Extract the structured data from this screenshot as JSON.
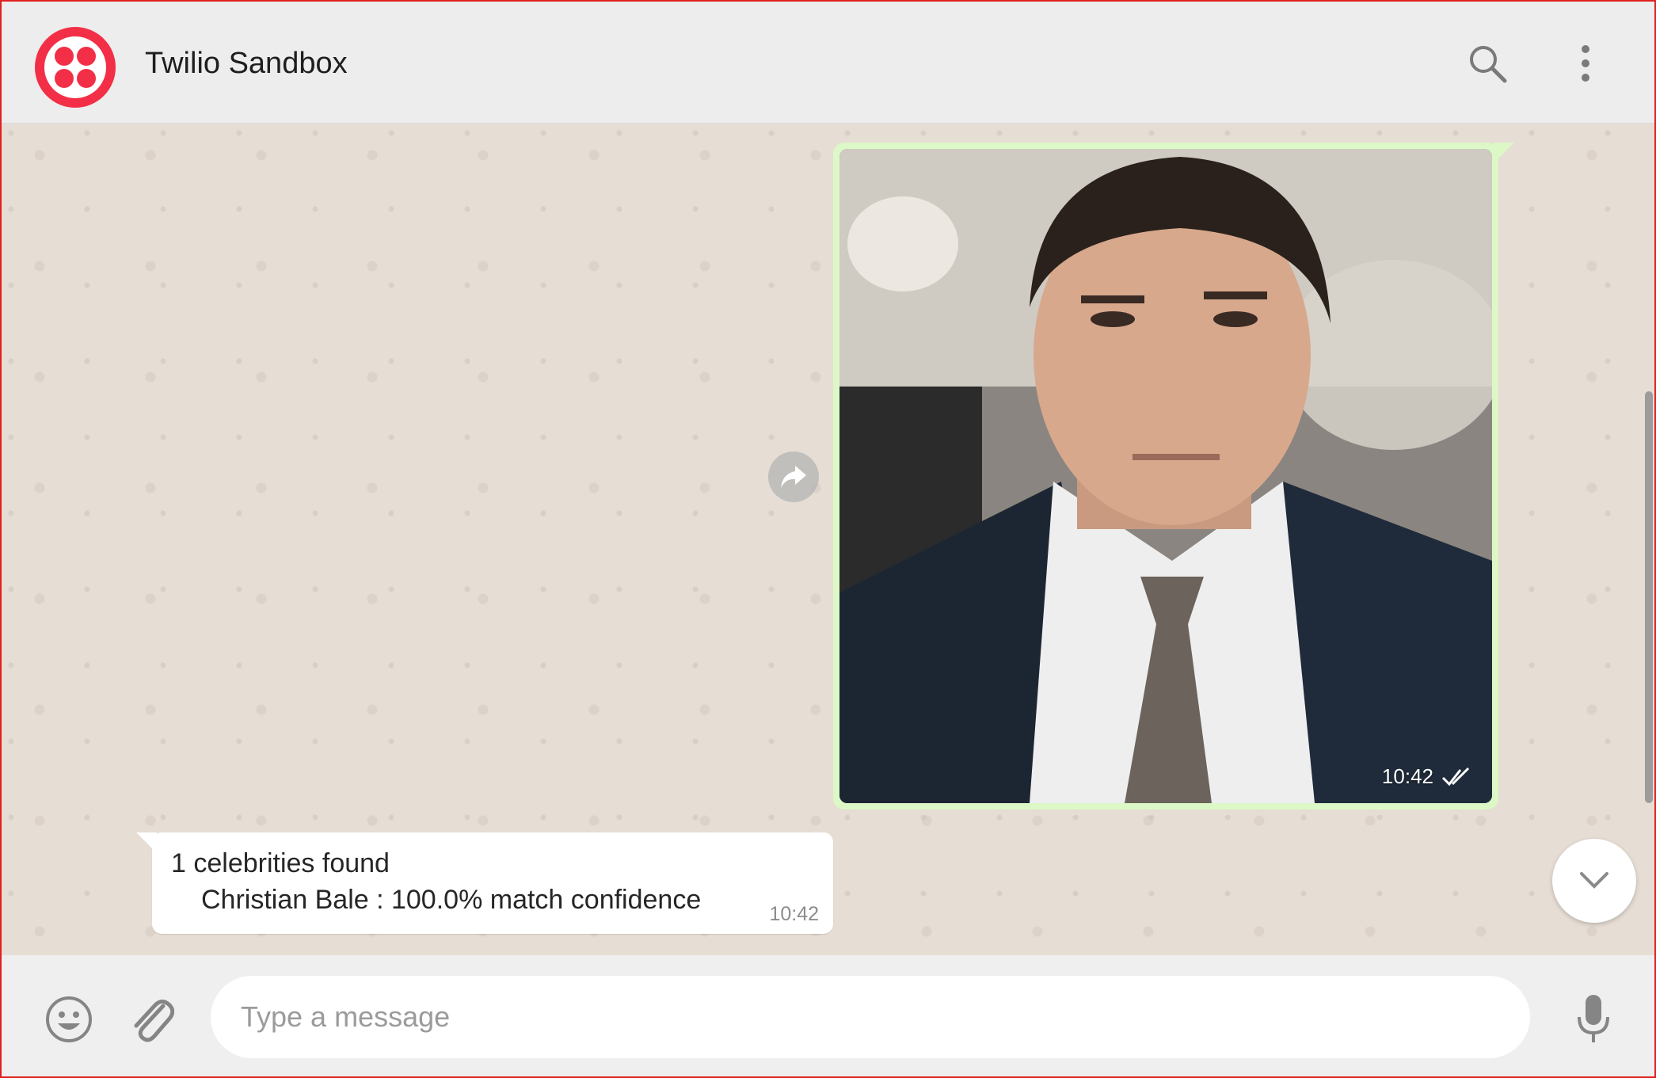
{
  "header": {
    "contact_name": "Twilio Sandbox",
    "avatar_icon": "twilio-logo",
    "brand_color": "#f22f46",
    "search_icon": "search-icon",
    "menu_icon": "more-vertical-icon"
  },
  "messages": [
    {
      "direction": "outgoing",
      "type": "image",
      "image_description": "photo",
      "time": "10:42",
      "status_icon": "double-check-icon"
    },
    {
      "direction": "incoming",
      "type": "text",
      "line1": "1 celebrities found",
      "line2": "Christian Bale : 100.0% match confidence",
      "time": "10:42"
    }
  ],
  "footer": {
    "emoji_icon": "emoji-icon",
    "attach_icon": "paperclip-icon",
    "input_placeholder": "Type a message",
    "mic_icon": "microphone-icon"
  },
  "colors": {
    "chat_background": "#e6ddd4",
    "outgoing_bubble": "#dcf8c6",
    "incoming_bubble": "#ffffff",
    "header_background": "#ededed"
  }
}
